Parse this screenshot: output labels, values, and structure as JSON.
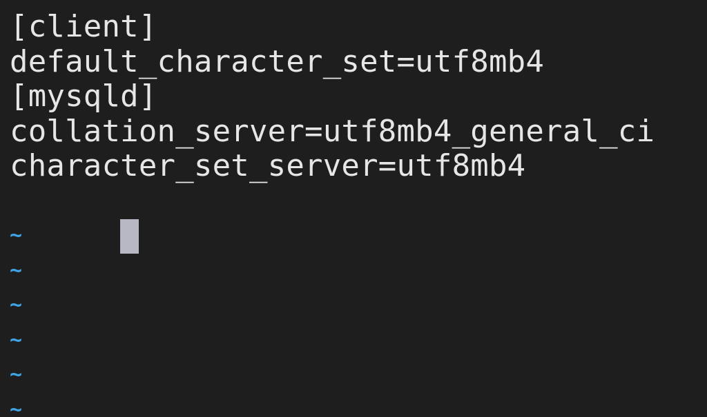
{
  "editor": {
    "lines": [
      "[client]",
      "default_character_set=utf8mb4",
      "[mysqld]",
      "collation_server=utf8mb4_general_ci",
      "character_set_server=utf8mb4"
    ],
    "empty_line_marker": "~",
    "empty_line_count": 6
  },
  "colors": {
    "background": "#1e1e1e",
    "text": "#e6e6e6",
    "cursor": "#b8b8c4",
    "tilde": "#3fa4e6"
  }
}
